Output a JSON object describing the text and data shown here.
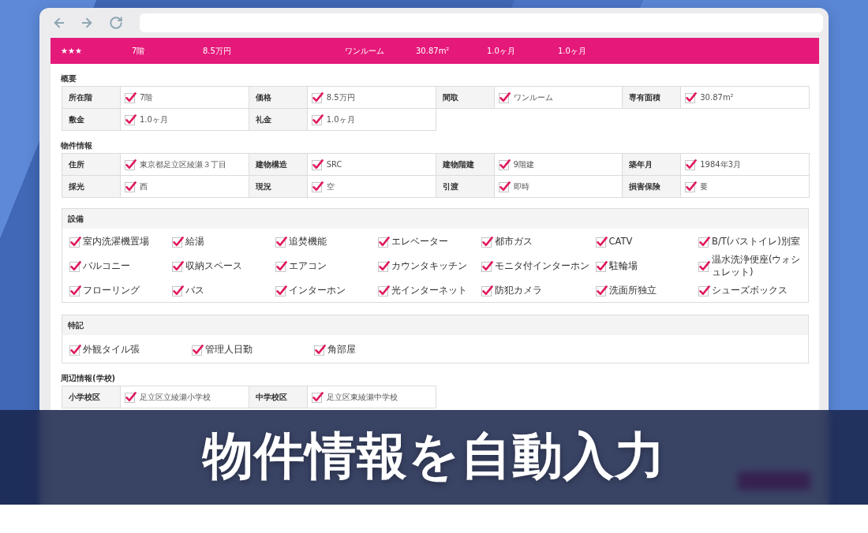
{
  "summary_bar": [
    "★★★",
    "7階",
    "8.5万円",
    "ワンルーム",
    "30.87m²",
    "1.0ヶ月",
    "1.0ヶ月"
  ],
  "overview": {
    "title": "概要",
    "rows": [
      [
        {
          "label": "所在階",
          "value": "7階",
          "checked": true
        },
        {
          "label": "価格",
          "value": "8.5万円",
          "checked": true
        },
        {
          "label": "間取",
          "value": "ワンルーム",
          "checked": true
        },
        {
          "label": "専有面積",
          "value": "30.87m²",
          "checked": true
        }
      ],
      [
        {
          "label": "敷金",
          "value": "1.0ヶ月",
          "checked": true
        },
        {
          "label": "礼金",
          "value": "1.0ヶ月",
          "checked": true
        }
      ]
    ]
  },
  "property_info": {
    "title": "物件情報",
    "rows": [
      [
        {
          "label": "住所",
          "value": "東京都足立区綾瀬３丁目",
          "checked": true
        },
        {
          "label": "建物構造",
          "value": "SRC",
          "checked": true
        },
        {
          "label": "建物階建",
          "value": "9階建",
          "checked": true
        },
        {
          "label": "築年月",
          "value": "1984年3月",
          "checked": true
        }
      ],
      [
        {
          "label": "採光",
          "value": "西",
          "checked": true
        },
        {
          "label": "現況",
          "value": "空",
          "checked": true
        },
        {
          "label": "引渡",
          "value": "即時",
          "checked": true
        },
        {
          "label": "損害保険",
          "value": "要",
          "checked": true
        }
      ]
    ]
  },
  "equipment": {
    "title": "設備",
    "items": [
      {
        "label": "室内洗濯機置場",
        "checked": true
      },
      {
        "label": "給湯",
        "checked": true
      },
      {
        "label": "追焚機能",
        "checked": true
      },
      {
        "label": "エレベーター",
        "checked": true
      },
      {
        "label": "都市ガス",
        "checked": true
      },
      {
        "label": "CATV",
        "checked": true
      },
      {
        "label": "B/T(バストイレ)別室",
        "checked": true
      },
      {
        "label": "バルコニー",
        "checked": true
      },
      {
        "label": "収納スペース",
        "checked": true
      },
      {
        "label": "エアコン",
        "checked": true
      },
      {
        "label": "カウンタキッチン",
        "checked": true
      },
      {
        "label": "モニタ付インターホン",
        "checked": true
      },
      {
        "label": "駐輪場",
        "checked": true
      },
      {
        "label": "温水洗浄便座(ウォシュレット)",
        "checked": true
      },
      {
        "label": "フローリング",
        "checked": true
      },
      {
        "label": "バス",
        "checked": true
      },
      {
        "label": "インターホン",
        "checked": true
      },
      {
        "label": "光インターネット",
        "checked": true
      },
      {
        "label": "防犯カメラ",
        "checked": true
      },
      {
        "label": "洗面所独立",
        "checked": true
      },
      {
        "label": "シューズボックス",
        "checked": true
      }
    ]
  },
  "features": {
    "title": "特記",
    "items": [
      {
        "label": "外観タイル張",
        "checked": true
      },
      {
        "label": "管理人日勤",
        "checked": true
      },
      {
        "label": "角部屋",
        "checked": true
      }
    ]
  },
  "nearby_schools": {
    "title": "周辺情報(学校)",
    "rows": [
      [
        {
          "label": "小学校区",
          "value": "足立区立綾瀬小学校",
          "checked": true
        },
        {
          "label": "中学校区",
          "value": "足立区東綾瀬中学校",
          "checked": true
        }
      ]
    ]
  },
  "banner": {
    "title": "物件情報を自動入力"
  }
}
